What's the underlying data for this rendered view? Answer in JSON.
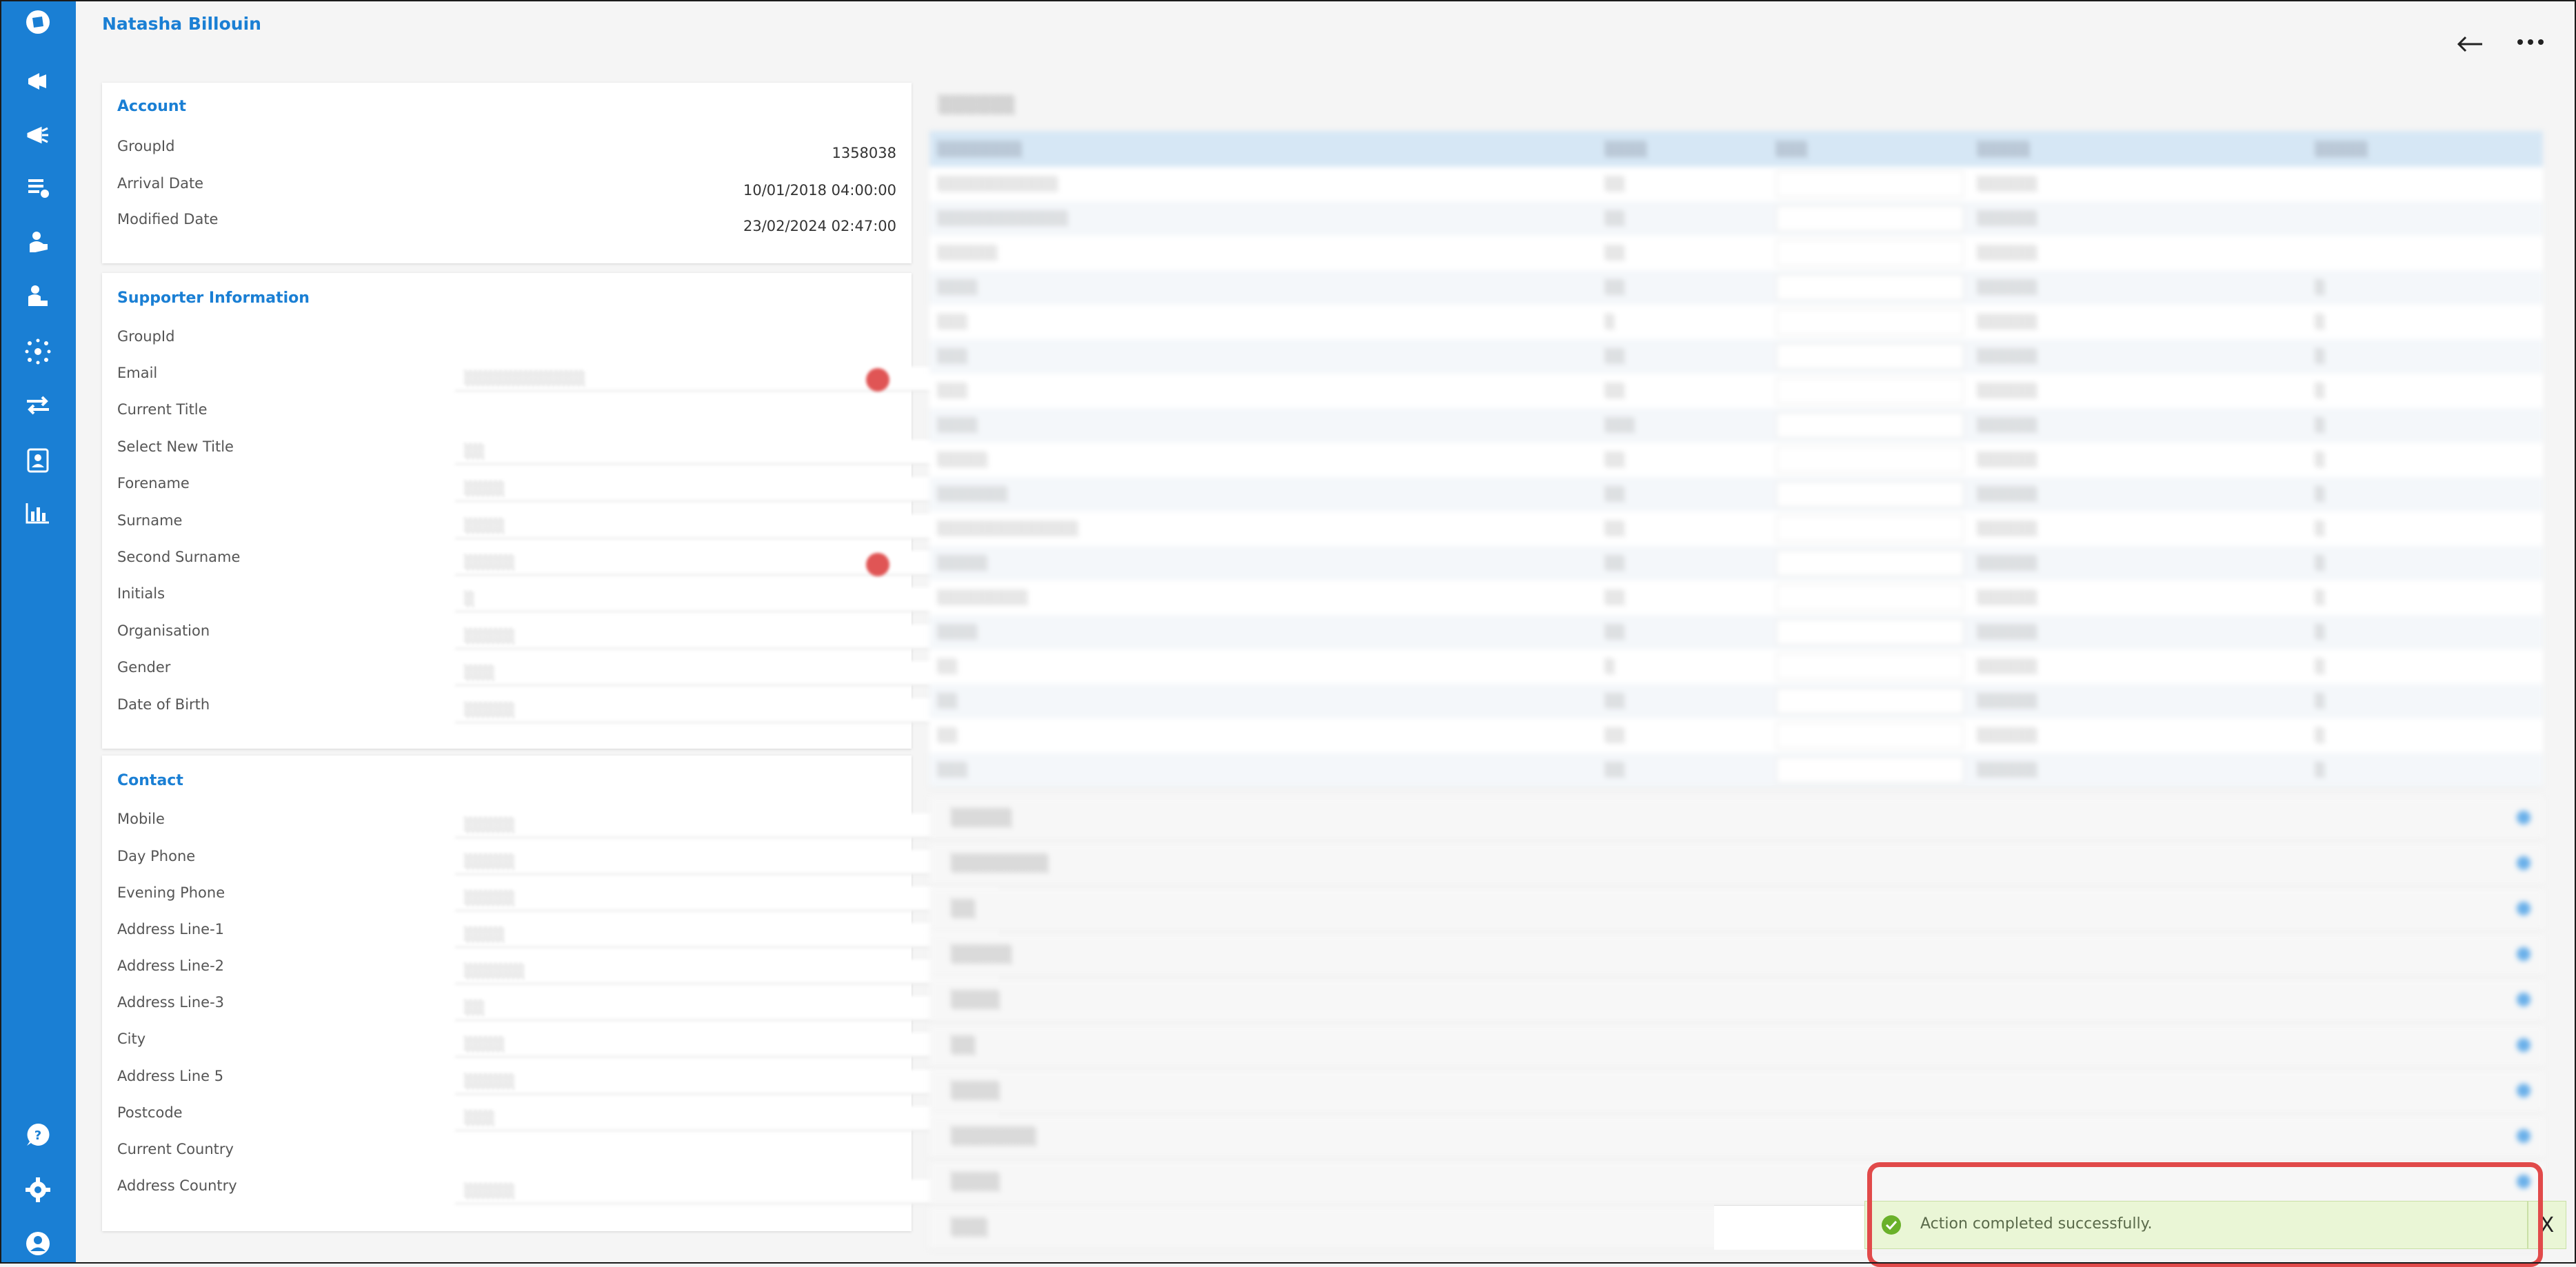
{
  "header": {
    "user_name": "Natasha Billouin"
  },
  "sidebar": {
    "icons": [
      "logo-icon",
      "campaign-icon",
      "campaign-out-icon",
      "list-icon",
      "supporter-icon",
      "volunteer-icon",
      "network-icon",
      "transfer-icon",
      "contact-card-icon",
      "report-icon",
      "help-icon",
      "settings-icon",
      "account-icon"
    ]
  },
  "account": {
    "title": "Account",
    "rows": [
      {
        "label": "GroupId",
        "value": "1358038"
      },
      {
        "label": "Arrival Date",
        "value": "10/01/2018 04:00:00"
      },
      {
        "label": "Modified Date",
        "value": "23/02/2024 02:47:00"
      }
    ]
  },
  "supporter": {
    "title": "Supporter Information",
    "labels": [
      "GroupId",
      "Email",
      "Current Title",
      "Select New Title",
      "Forename",
      "Surname",
      "Second Surname",
      "Initials",
      "Organisation",
      "Gender",
      "Date of Birth"
    ]
  },
  "contact": {
    "title": "Contact",
    "labels": [
      "Mobile",
      "Day Phone",
      "Evening Phone",
      "Address Line-1",
      "Address Line-2",
      "Address Line-3",
      "City",
      "Address Line 5",
      "Postcode",
      "Current Country",
      "Address Country"
    ]
  },
  "toast": {
    "message": "Action completed successfully.",
    "close_label": "X"
  },
  "colors": {
    "brand": "#1a7fd4",
    "toast_bg": "#eaf6d6",
    "highlight": "#e14a4a"
  }
}
